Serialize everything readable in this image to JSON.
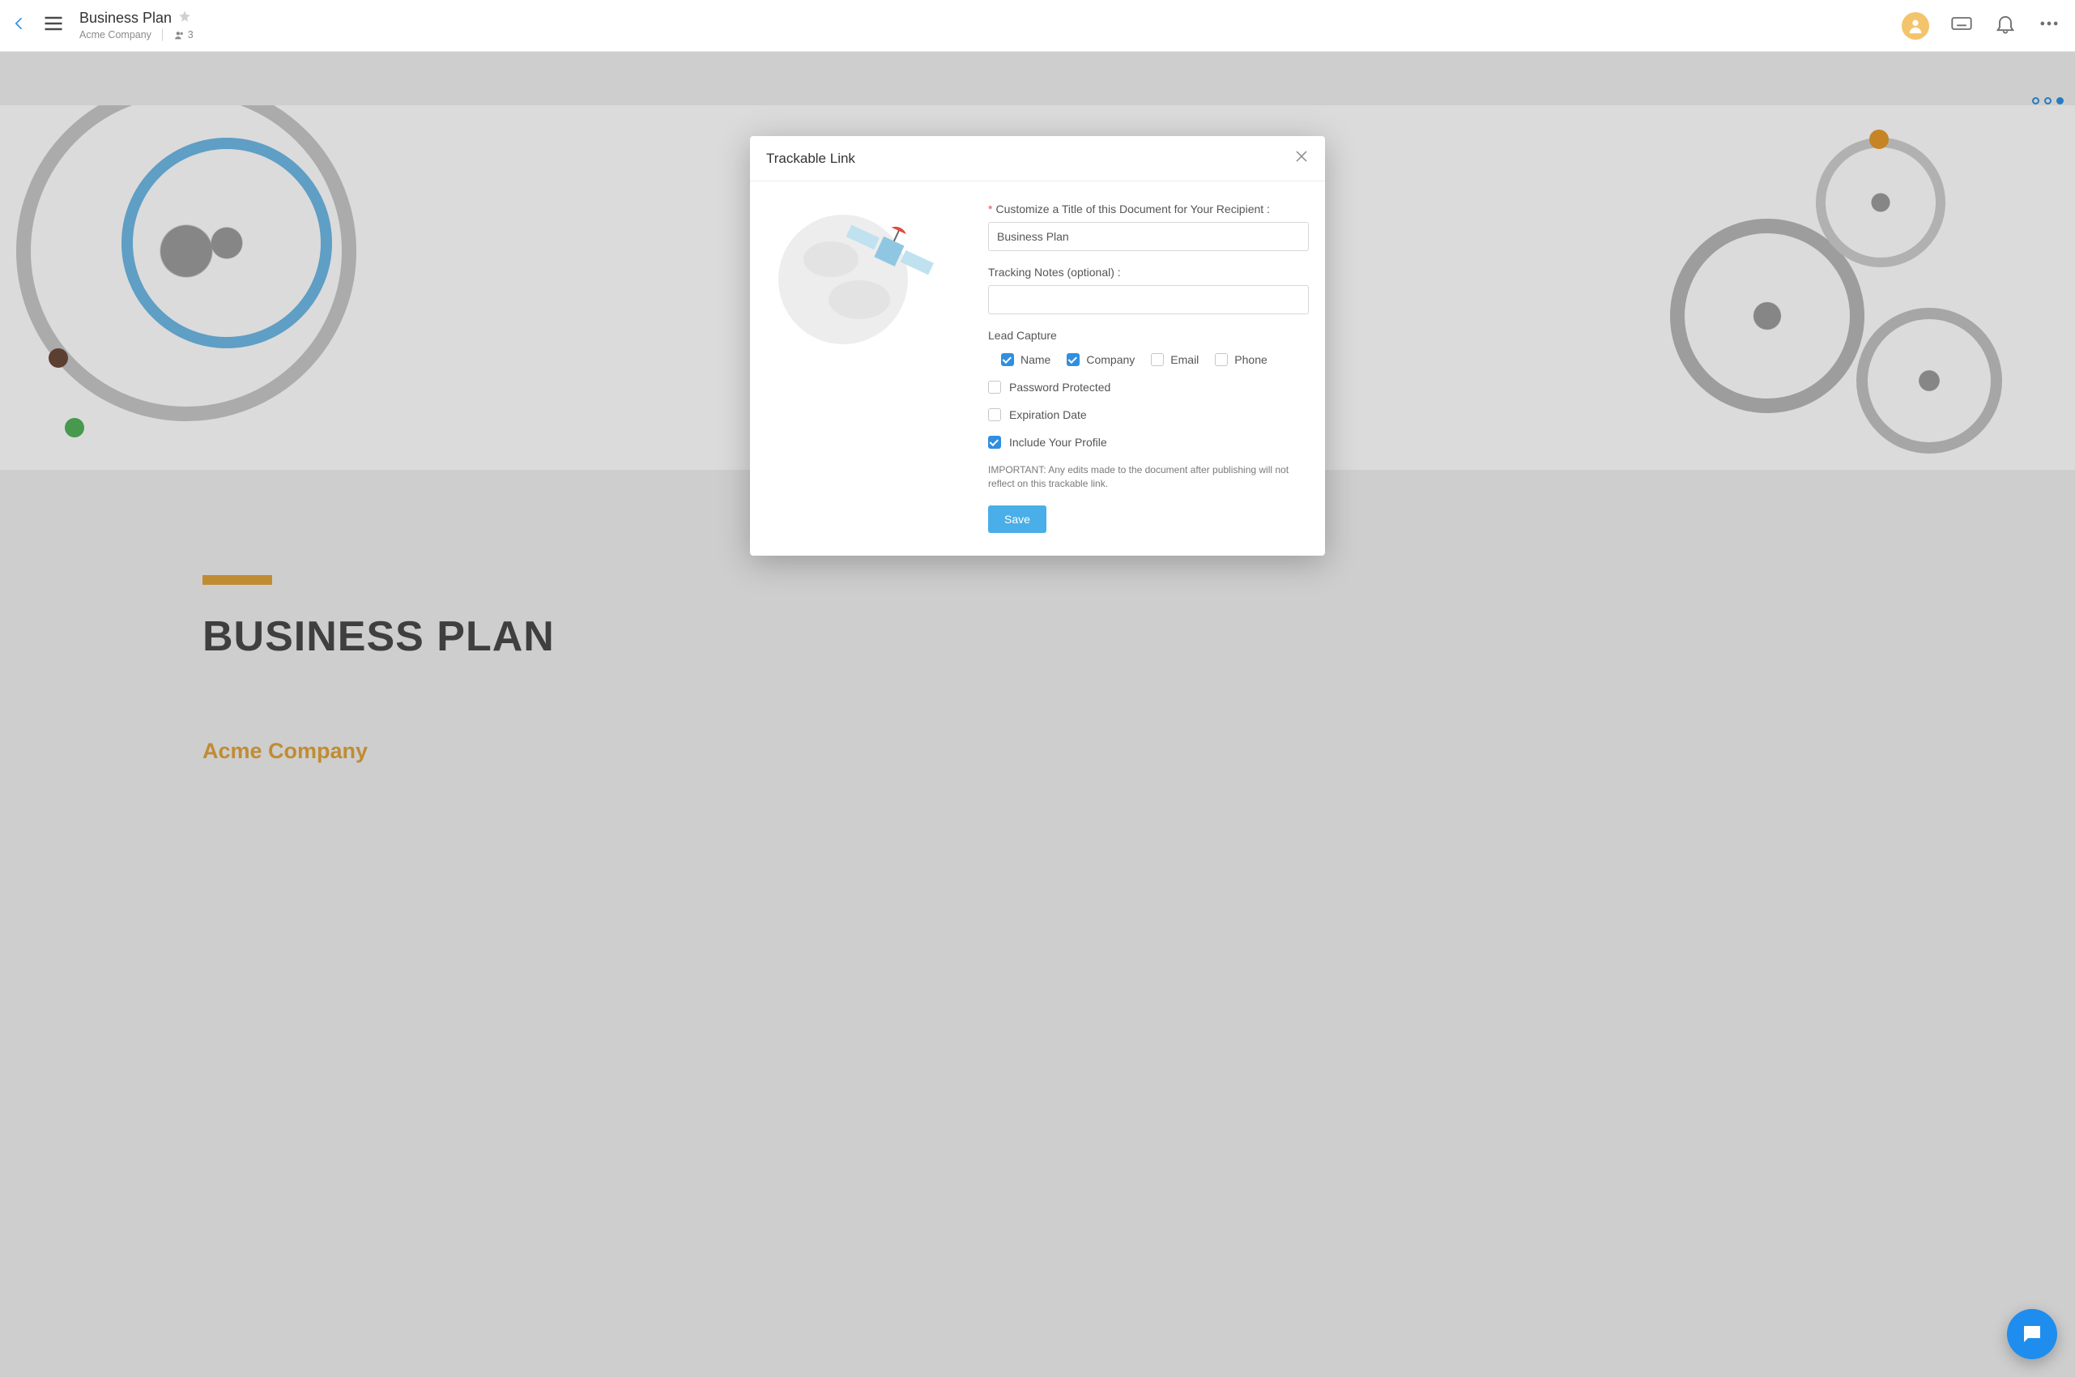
{
  "header": {
    "doc_title": "Business Plan",
    "company": "Acme Company",
    "people_count": "3"
  },
  "page": {
    "heading": "BUSINESS PLAN",
    "subheading": "Acme Company"
  },
  "modal": {
    "title": "Trackable Link",
    "title_field_label": "Customize a Title of this Document for Your Recipient :",
    "title_field_value": "Business Plan",
    "notes_label": "Tracking Notes (optional) :",
    "notes_value": "",
    "lead_capture_label": "Lead Capture",
    "lead_capture": {
      "name": {
        "label": "Name",
        "checked": true
      },
      "company": {
        "label": "Company",
        "checked": true
      },
      "email": {
        "label": "Email",
        "checked": false
      },
      "phone": {
        "label": "Phone",
        "checked": false
      }
    },
    "password_protected": {
      "label": "Password Protected",
      "checked": false
    },
    "expiration_date": {
      "label": "Expiration Date",
      "checked": false
    },
    "include_profile": {
      "label": "Include Your Profile",
      "checked": true
    },
    "fine_print": "IMPORTANT: Any edits made to the document after publishing will not reflect on this trackable link.",
    "save_label": "Save"
  }
}
